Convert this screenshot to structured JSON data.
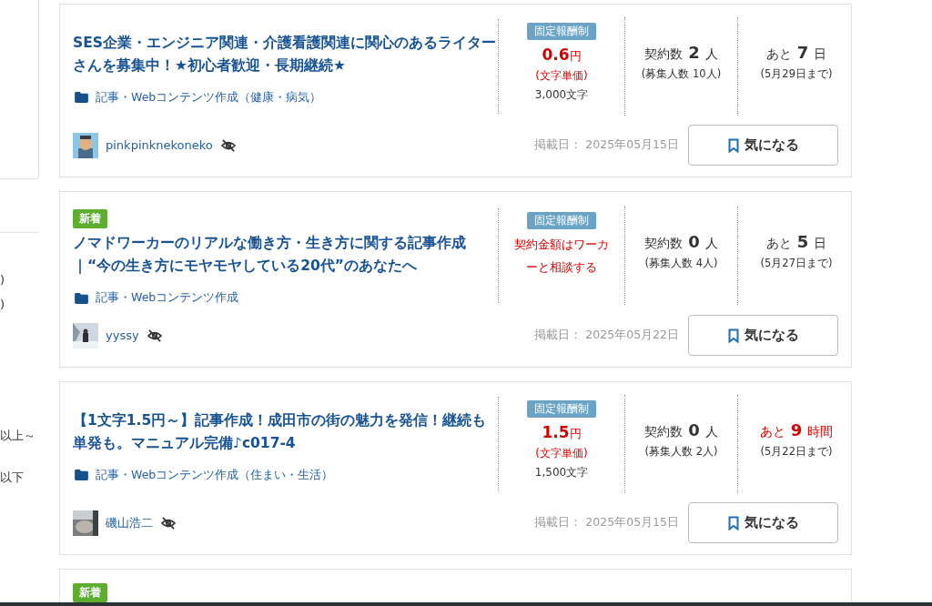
{
  "sidebar": {
    "fragments": [
      ")",
      ")",
      "以上～",
      "以下"
    ]
  },
  "jobs": [
    {
      "title": "SES企業・エンジニア関連・介護看護関連に関心のあるライターさんを募集中！★初心者歓迎・長期継続★",
      "category": "記事・Webコンテンツ作成（健康・病気）",
      "user": {
        "name": "pinkpinknekoneko"
      },
      "pay": {
        "badge": "固定報酬制",
        "kind": "unit",
        "amount": "0.6",
        "unit": "円",
        "note": "(文字単価)",
        "chars": "3,000文字"
      },
      "contracts": {
        "label": "契約数",
        "count": "2",
        "unit": "人",
        "recruit": "(募集人数 10人)"
      },
      "deadline": {
        "prefix": "あと",
        "value": "7",
        "unit": "日",
        "urgent": false,
        "until": "(5月29日まで)"
      },
      "posted": "掲載日： 2025年05月15日",
      "button": "気になる"
    },
    {
      "badge": "新着",
      "title": "ノマドワーカーのリアルな働き方・生き方に関する記事作成｜“今の生き方にモヤモヤしている20代”のあなたへ",
      "category": "記事・Webコンテンツ作成",
      "user": {
        "name": "yyssy"
      },
      "pay": {
        "badge": "固定報酬制",
        "kind": "consult",
        "text": "契約金額はワーカーと相談する"
      },
      "contracts": {
        "label": "契約数",
        "count": "0",
        "unit": "人",
        "recruit": "(募集人数 4人)"
      },
      "deadline": {
        "prefix": "あと",
        "value": "5",
        "unit": "日",
        "urgent": false,
        "until": "(5月27日まで)"
      },
      "posted": "掲載日： 2025年05月22日",
      "button": "気になる"
    },
    {
      "title": "【1文字1.5円～】記事作成！成田市の街の魅力を発信！継続も単発も。マニュアル完備♪c017-4",
      "category": "記事・Webコンテンツ作成（住まい・生活）",
      "user": {
        "name": "磯山浩二"
      },
      "pay": {
        "badge": "固定報酬制",
        "kind": "unit",
        "amount": "1.5",
        "unit": "円",
        "note": "(文字単価)",
        "chars": "1,500文字"
      },
      "contracts": {
        "label": "契約数",
        "count": "0",
        "unit": "人",
        "recruit": "(募集人数 2人)"
      },
      "deadline": {
        "prefix": "あと",
        "value": "9",
        "unit": "時間",
        "urgent": true,
        "until": "(5月22日まで)"
      },
      "posted": "掲載日： 2025年05月15日",
      "button": "気になる"
    },
    {
      "badge": "新着"
    }
  ]
}
